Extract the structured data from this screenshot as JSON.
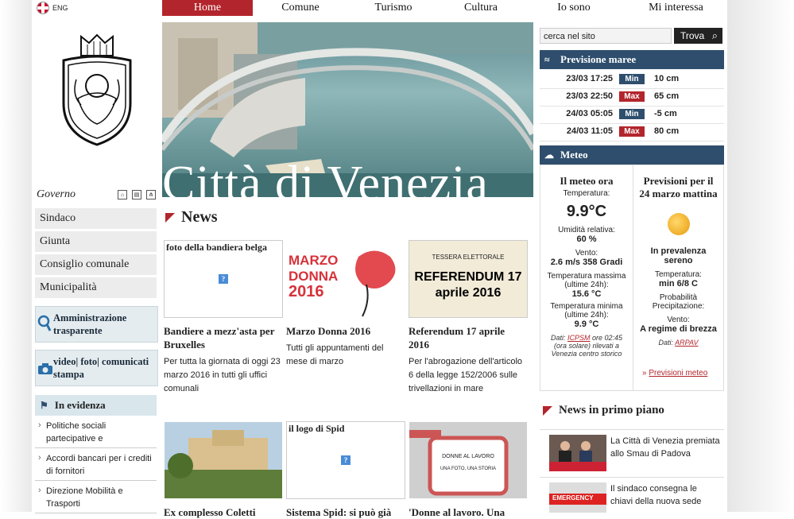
{
  "language": "ENG",
  "nav": [
    "Home",
    "Comune",
    "Turismo",
    "Cultura",
    "Io sono",
    "Mi interessa"
  ],
  "governo": "Governo",
  "menu": [
    "Sindaco",
    "Giunta",
    "Consiglio comunale",
    "Municipalità"
  ],
  "boxes": {
    "amministrazione": "Amministrazione trasparente",
    "video": "video| foto| comunicati stampa"
  },
  "evidenza": {
    "title": "In evidenza",
    "items": [
      "Politiche sociali partecipative e",
      "Accordi bancari per i crediti di fornitori",
      "Direzione Mobilità e Trasporti"
    ]
  },
  "hero_title": "Città di Venezia",
  "news": {
    "title": "News",
    "cards": [
      {
        "img_text": "foto della bandiera belga",
        "title": "Bandiere a mezz'asta per Bruxelles",
        "text": "Per tutta la giornata di oggi 23 marzo 2016 in tutti gli uffici comunali"
      },
      {
        "img_text": "MARZO DONNA 2016",
        "title": "Marzo Donna 2016",
        "text": "Tutti gli appuntamenti del mese di marzo"
      },
      {
        "img_text": "REFERENDUM 17 aprile 2016",
        "img_sub": "TESSERA ELETTORALE",
        "title": "Referendum 17 aprile 2016",
        "text": "Per l'abrogazione dell'articolo 6 della legge 152/2006 sulle trivellazioni in mare"
      },
      {
        "img_text": "",
        "title": "Ex complesso Coletti",
        "text": ""
      },
      {
        "img_text": "il logo di Spid",
        "title": "Sistema Spid: si può già",
        "text": ""
      },
      {
        "img_text": "DONNE AL LAVORO",
        "img_sub": "UNA FOTO, UNA STORIA",
        "title": "'Donne al lavoro. Una",
        "text": ""
      }
    ]
  },
  "search": {
    "placeholder": "cerca nel sito",
    "button": "Trova"
  },
  "maree": {
    "title": "Previsione maree",
    "rows": [
      {
        "time": "23/03 17:25",
        "type": "Min",
        "value": "10 cm"
      },
      {
        "time": "23/03 22:50",
        "type": "Max",
        "value": "65 cm"
      },
      {
        "time": "24/03 05:05",
        "type": "Min",
        "value": "-5 cm"
      },
      {
        "time": "24/03 11:05",
        "type": "Max",
        "value": "80 cm"
      }
    ]
  },
  "meteo": {
    "title": "Meteo",
    "now": {
      "title": "Il meteo ora",
      "temp_label": "Temperatura:",
      "temp": "9.9°C",
      "hum_label": "Umidità relativa:",
      "hum": "60 %",
      "wind_label": "Vento:",
      "wind": "2.6 m/s 358 Gradi",
      "tmax_label": "Temperatura massima (ultime 24h):",
      "tmax": "15.6 °C",
      "tmin_label": "Temperatura minima (ultime 24h):",
      "tmin": "9.9 °C",
      "source_pre": "Dati:",
      "source": "ICPSM",
      "source_post": "ore 02:45 (ora solare) rilevati a Venezia centro storico"
    },
    "forecast": {
      "title": "Previsioni per il 24 marzo mattina",
      "sky": "In prevalenza sereno",
      "temp_label": "Temperatura:",
      "temp": "min 6/8 C",
      "prob_label": "Probabilità Precipitazione:",
      "wind_label": "Vento:",
      "wind": "A regime di brezza",
      "source_pre": "Dati:",
      "source": "ARPAV",
      "link": "Previsioni meteo"
    }
  },
  "primo_piano": {
    "title": "News in primo piano",
    "items": [
      "La Città di Venezia premiata allo Smau di Padova",
      "Il sindaco consegna le chiavi della nuova sede"
    ],
    "thumb_text": "EMERGENCY"
  },
  "colors": {
    "accent": "#b3252c",
    "panel": "#2f4e6d",
    "min": "#2f4e6d",
    "max": "#b3252c"
  }
}
